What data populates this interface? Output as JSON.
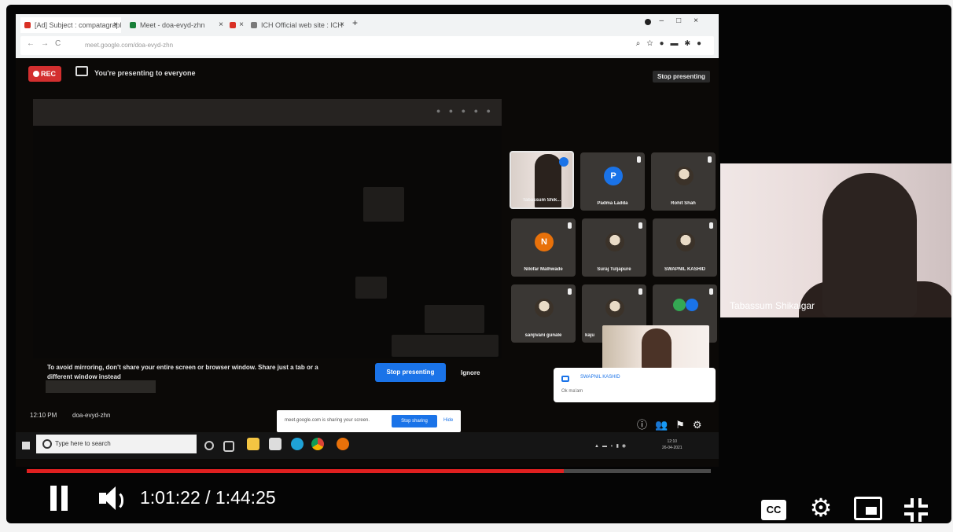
{
  "browser": {
    "tabs": [
      {
        "label": "[Ad] Subject : compatagraph geo"
      },
      {
        "label": "Meet - doa-evyd-zhn"
      },
      {
        "label": ""
      },
      {
        "label": "ICH Official web site : ICH"
      }
    ],
    "url": "meet.google.com/doa-evyd-zhn"
  },
  "meet": {
    "rec_label": "REC",
    "presenting_text": "You're presenting to everyone",
    "stop_presenting_top": "Stop presenting",
    "warning_text": "To avoid mirroring, don't share your entire screen or browser window. Share just a tab or a different window instead",
    "stop_presenting_btn": "Stop presenting",
    "ignore_btn": "Ignore",
    "clock": "12:10 PM",
    "meeting_code": "doa-evyd-zhn",
    "share_notice": "meet.google.com is sharing your screen.",
    "stop_sharing": "Stop sharing",
    "hide": "Hide",
    "participants": [
      {
        "name": "Tabassum Shik..."
      },
      {
        "name": "Padma Ladda",
        "initial": "P",
        "color": "#1a73e8"
      },
      {
        "name": "Rohit Shah"
      },
      {
        "name": "Nilofar Malhwade",
        "initial": "N",
        "color": "#e8710a"
      },
      {
        "name": "Suraj Tuljapure"
      },
      {
        "name": "SWAPNIL KASHID"
      },
      {
        "name": "sanjivani gunale"
      },
      {
        "name": "kaju"
      },
      {
        "name": ""
      }
    ],
    "chat": {
      "sender": "SWAPNIL KASHID",
      "message": "Ok ma'am"
    }
  },
  "taskbar": {
    "search_placeholder": "Type here to search"
  },
  "speaker": {
    "name": "Tabassum Shikalgar"
  },
  "player": {
    "time_display": "1:01:22 / 1:44:25",
    "progress_fraction": 0.7847,
    "cc_label": "CC"
  },
  "colors": {
    "progress": "#e02020",
    "meet_blue": "#1a73e8",
    "rec_red": "#d32f2f"
  },
  "icons": [
    "pause-icon",
    "volume-icon",
    "cc-icon",
    "gear-icon",
    "miniplayer-icon",
    "exit-fullscreen-icon"
  ]
}
